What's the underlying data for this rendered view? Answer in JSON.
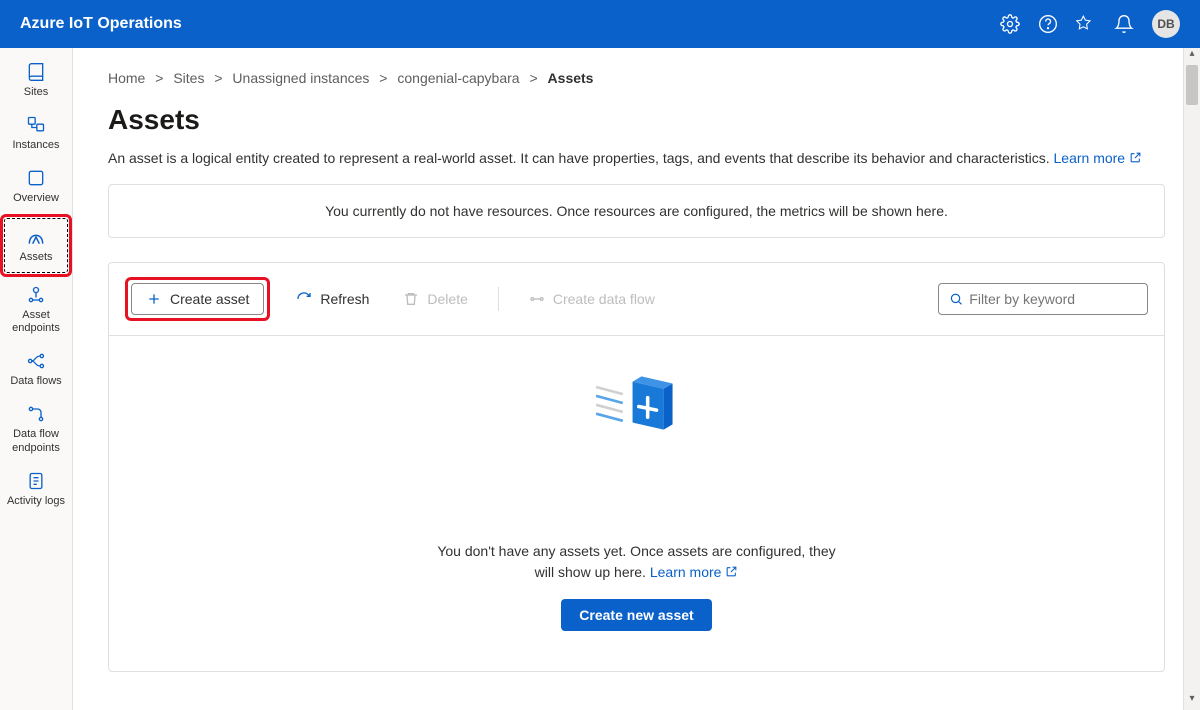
{
  "header": {
    "brand": "Azure IoT Operations",
    "avatar_initials": "DB"
  },
  "sidebar": {
    "items": [
      {
        "label": "Sites",
        "icon": "book-icon"
      },
      {
        "label": "Instances",
        "icon": "instances-icon"
      },
      {
        "label": "Overview",
        "icon": "overview-icon"
      },
      {
        "label": "Assets",
        "icon": "asset-icon"
      },
      {
        "label": "Asset endpoints",
        "icon": "asset-endpoint-icon"
      },
      {
        "label": "Data flows",
        "icon": "dataflow-icon"
      },
      {
        "label": "Data flow endpoints",
        "icon": "dataflow-endpoint-icon"
      },
      {
        "label": "Activity logs",
        "icon": "activitylog-icon"
      }
    ],
    "selected_index": 3
  },
  "breadcrumb": {
    "items": [
      {
        "label": "Home"
      },
      {
        "label": "Sites"
      },
      {
        "label": "Unassigned instances"
      },
      {
        "label": "congenial-capybara"
      },
      {
        "label": "Assets",
        "current": true
      }
    ]
  },
  "page": {
    "title": "Assets",
    "description": "An asset is a logical entity created to represent a real-world asset. It can have properties, tags, and events that describe its behavior and characteristics.",
    "learn_more": "Learn more",
    "info_box": "You currently do not have resources. Once resources are configured, the metrics will be shown here."
  },
  "toolbar": {
    "create_asset": "Create asset",
    "refresh": "Refresh",
    "delete": "Delete",
    "create_dataflow": "Create data flow",
    "filter_placeholder": "Filter by keyword"
  },
  "empty_state": {
    "text_prefix": "You don't have any assets yet. Once assets are configured, they will show up here.",
    "learn_more": "Learn more",
    "button": "Create new asset"
  }
}
